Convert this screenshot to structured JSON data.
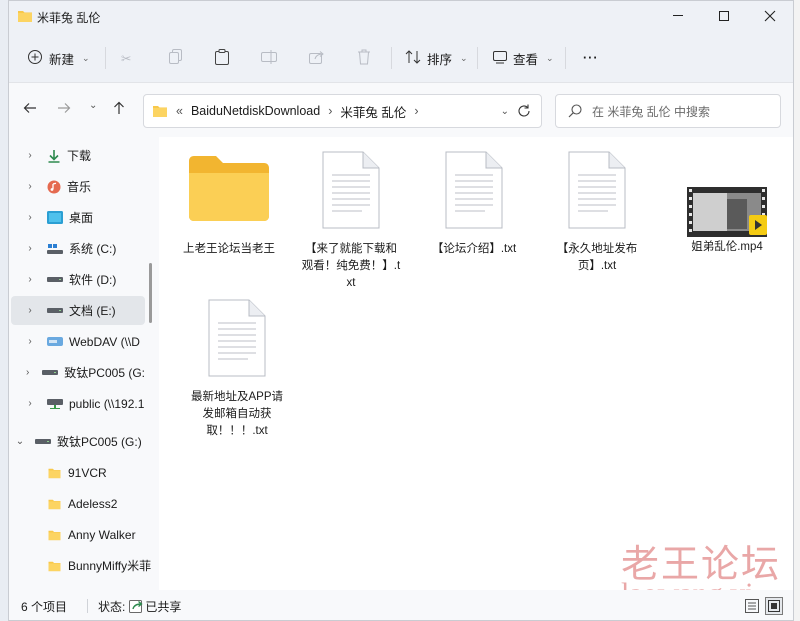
{
  "window": {
    "title": "米菲兔 乱伦"
  },
  "toolbar": {
    "new_label": "新建",
    "sort_label": "排序",
    "view_label": "查看",
    "more_label": "···"
  },
  "address": {
    "prefix": "«",
    "crumbs": [
      "BaiduNetdiskDownload",
      "米菲兔 乱伦"
    ],
    "sep": "›"
  },
  "search": {
    "placeholder": "在 米菲兔 乱伦 中搜索"
  },
  "sidebar": {
    "items": [
      {
        "label": "下载",
        "icon": "download-icon"
      },
      {
        "label": "音乐",
        "icon": "music-icon"
      },
      {
        "label": "桌面",
        "icon": "desktop-icon"
      },
      {
        "label": "系统 (C:)",
        "icon": "drive-c-icon"
      },
      {
        "label": "软件 (D:)",
        "icon": "drive-icon"
      },
      {
        "label": "文档 (E:)",
        "icon": "drive-icon"
      },
      {
        "label": "WebDAV (\\\\D",
        "icon": "webdav-icon"
      },
      {
        "label": "致钛PC005 (G:",
        "icon": "drive-icon"
      },
      {
        "label": "public (\\\\192.1",
        "icon": "network-drive-icon"
      }
    ],
    "drive_root": {
      "label": "致钛PC005 (G:)",
      "icon": "drive-icon"
    },
    "folders": [
      "91VCR",
      "Adeless2",
      "Anny Walker",
      "BunnyMiffy米菲"
    ]
  },
  "files": [
    {
      "name": "上老王论坛当老王",
      "type": "folder"
    },
    {
      "name": "【来了就能下载和观看！纯免费！】.txt",
      "type": "text"
    },
    {
      "name": "【论坛介绍】.txt",
      "type": "text"
    },
    {
      "name": "【永久地址发布页】.txt",
      "type": "text"
    },
    {
      "name": "姐弟乱伦.mp4",
      "type": "video"
    },
    {
      "name": "最新地址及APP请发邮箱自动获取！！！.txt",
      "type": "text"
    }
  ],
  "status": {
    "count": "6 个项目",
    "state_label": "状态:",
    "state_value": "已共享"
  },
  "watermark": {
    "line1": "老王论坛",
    "line2": "laowang.vi"
  },
  "colors": {
    "folder": "#f8c84a",
    "accent": "#0067c0",
    "watermark": "#e9a7a7"
  }
}
